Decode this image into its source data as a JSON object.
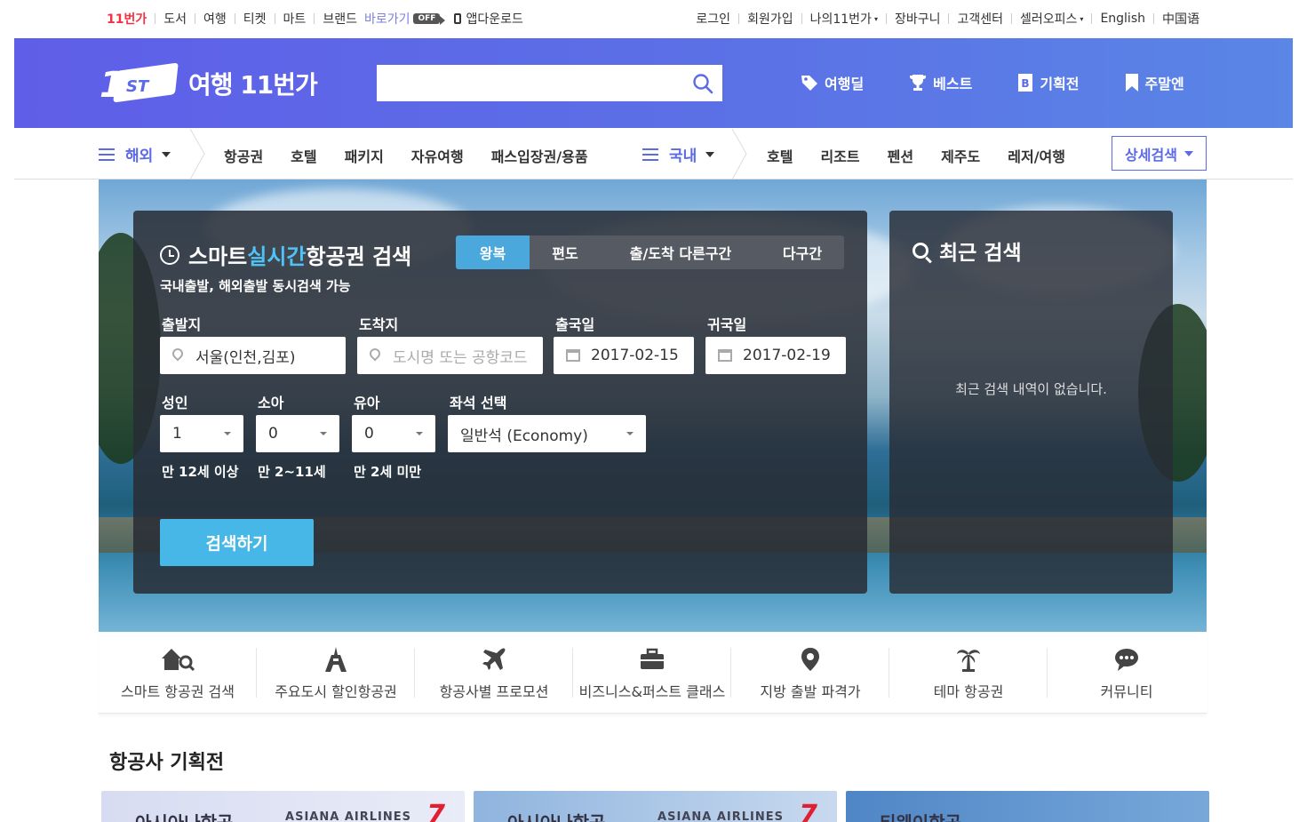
{
  "topbar": {
    "left": {
      "brand": "11번가",
      "items": [
        "도서",
        "여행",
        "티켓",
        "마트",
        "브랜드"
      ],
      "shortcut": "바로가기",
      "off_badge": "OFF",
      "app_download": "앱다운로드"
    },
    "right": {
      "items": [
        "로그인",
        "회원가입",
        "나의11번가",
        "장바구니",
        "고객센터",
        "셀러오피스",
        "English",
        "中国语"
      ],
      "dropdown_marker": "▾"
    }
  },
  "header": {
    "logo_text": "여행 11번가",
    "logo_mark_num": "11",
    "logo_mark_st": "ST",
    "search_placeholder": "",
    "nav": [
      "여행딜",
      "베스트",
      "기획전",
      "주말엔"
    ]
  },
  "catnav": {
    "overseas_label": "해외",
    "overseas_items": [
      "항공권",
      "호텔",
      "패키지",
      "자유여행",
      "패스입장권/용품"
    ],
    "domestic_label": "국내",
    "domestic_items": [
      "호텔",
      "리조트",
      "펜션",
      "제주도",
      "레저/여행"
    ],
    "detail_search": "상세검색"
  },
  "flight_search": {
    "title_prefix": "스마트 ",
    "title_highlight": "실시간",
    "title_suffix": " 항공권 검색",
    "subtitle": "국내출발, 해외출발 동시검색 가능",
    "trip_tabs": [
      "왕복",
      "편도",
      "출/도착 다른구간",
      "다구간"
    ],
    "active_tab": "왕복",
    "departure_label": "출발지",
    "departure_value": "서울(인천,김포)",
    "arrival_label": "도착지",
    "arrival_placeholder": "도시명 또는 공항코드",
    "depart_date_label": "출국일",
    "depart_date": "2017-02-15",
    "return_date_label": "귀국일",
    "return_date": "2017-02-19",
    "adult_label": "성인",
    "adult_value": "1",
    "child_label": "소아",
    "child_value": "0",
    "infant_label": "유아",
    "infant_value": "0",
    "seat_label": "좌석 선택",
    "seat_value": "일반석 (Economy)",
    "adult_note": "만 12세 이상",
    "child_note": "만 2~11세",
    "infant_note": "만 2세 미만",
    "search_button": "검색하기"
  },
  "recent_search": {
    "title": "최근 검색",
    "empty_message": "최근 검색 내역이 없습니다."
  },
  "quick_menu": [
    {
      "label": "스마트 항공권 검색",
      "icon": "house-search-icon"
    },
    {
      "label": "주요도시 할인항공권",
      "icon": "eiffel-tower-icon"
    },
    {
      "label": "항공사별 프로모션",
      "icon": "airplane-icon"
    },
    {
      "label": "비즈니스&퍼스트 클래스",
      "icon": "briefcase-icon"
    },
    {
      "label": "지방 출발 파격가",
      "icon": "map-pin-icon"
    },
    {
      "label": "테마 항공권",
      "icon": "palm-tree-icon"
    },
    {
      "label": "커뮤니티",
      "icon": "chat-bubble-icon"
    }
  ],
  "promotions": {
    "section_title": "항공사 기획전",
    "banners": [
      {
        "text": "아시아나항공",
        "logo": "ASIANA AIRLINES"
      },
      {
        "text": "아시아나항공",
        "logo": "ASIANA AIRLINES"
      },
      {
        "text": "티웨이항공",
        "logo": ""
      }
    ]
  },
  "colors": {
    "brand_red": "#f43142",
    "header_blue": "#5b6ae6",
    "accent_sky": "#4fc3f7",
    "button_blue": "#46b7e6",
    "active_tab": "#4aa8dd"
  }
}
